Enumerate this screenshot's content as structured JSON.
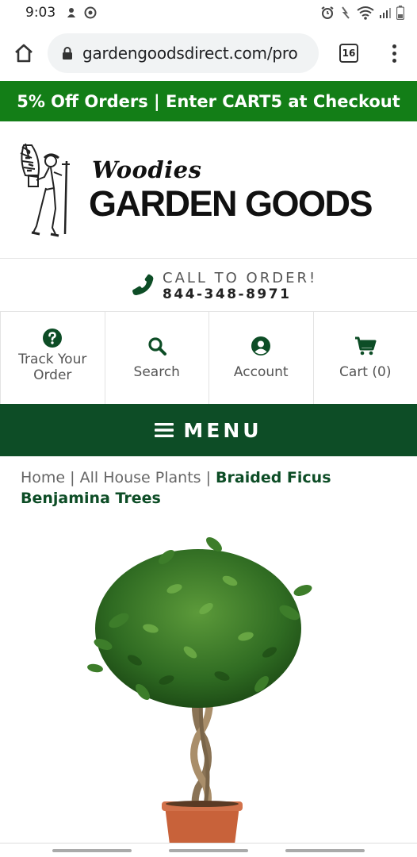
{
  "status_bar": {
    "time": "9:03"
  },
  "browser": {
    "url": "gardengoodsdirect.com/pro",
    "tab_count": "16"
  },
  "promo": {
    "text": "5% Off Orders | Enter CART5 at Checkout"
  },
  "logo": {
    "script_text": "Woodies",
    "main_text": "GARDEN GOODS"
  },
  "call": {
    "label": "CALL TO ORDER!",
    "number": "844-348-8971"
  },
  "quick_nav": [
    {
      "label": "Track Your Order",
      "icon": "question-circle-icon"
    },
    {
      "label": "Search",
      "icon": "search-icon"
    },
    {
      "label": "Account",
      "icon": "user-circle-icon"
    },
    {
      "label": "Cart (0)",
      "icon": "cart-icon"
    }
  ],
  "menu": {
    "label": "MENU"
  },
  "breadcrumb": {
    "home": "Home",
    "sep1": " | ",
    "category": "All House Plants",
    "sep2": " | ",
    "current": "Braided Ficus Benjamina Trees"
  },
  "colors": {
    "brand_green": "#137e17",
    "dark_green": "#0d4d26",
    "icon_green": "#0d4d26"
  }
}
